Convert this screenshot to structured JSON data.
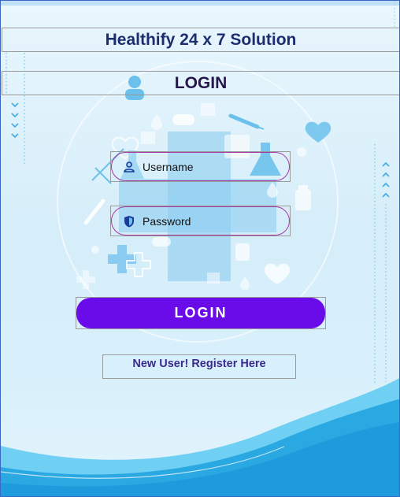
{
  "app": {
    "title": "Healthify 24 x 7 Solution",
    "screen_title": "LOGIN"
  },
  "form": {
    "username_placeholder": "Username",
    "password_placeholder": "Password",
    "login_button": "LOGIN",
    "register_link": "New User!  Register Here"
  },
  "icons": {
    "username": "user-icon",
    "password": "shield-lock-icon",
    "scroll_down": "chevron-down-icon",
    "scroll_up": "chevron-up-icon"
  },
  "colors": {
    "primary_button": "#6a0bea",
    "title_text": "#1c2e6e",
    "input_border": "#a33ba3",
    "wave": "#1e9bdc"
  }
}
